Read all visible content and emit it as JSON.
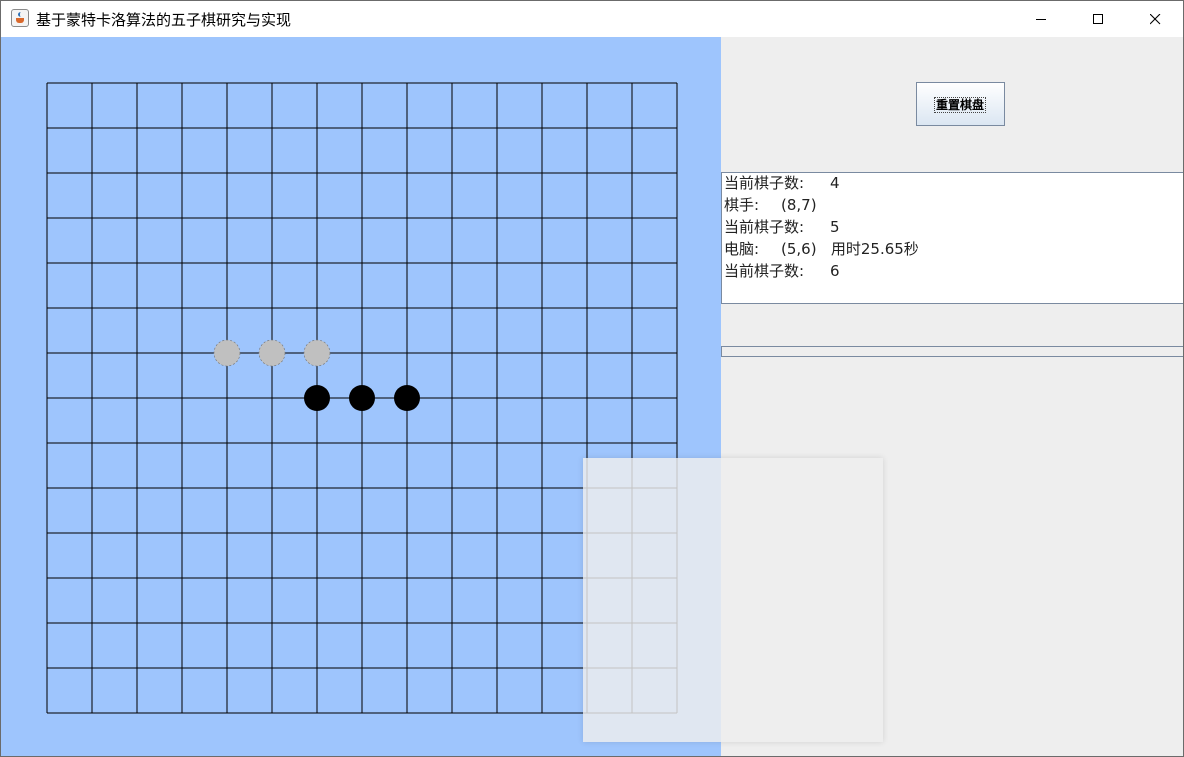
{
  "window": {
    "title": "基于蒙特卡洛算法的五子棋研究与实现",
    "icon": "java-cup-icon"
  },
  "colors": {
    "board_background": "#9ec5fd",
    "grid_line": "#000000",
    "white_stone": "#c0c0c0",
    "black_stone": "#000000",
    "panel_background": "#eeeeee"
  },
  "board": {
    "size": 15,
    "stones": [
      {
        "col": 4,
        "row": 6,
        "color": "white"
      },
      {
        "col": 5,
        "row": 6,
        "color": "white"
      },
      {
        "col": 6,
        "row": 6,
        "color": "white"
      },
      {
        "col": 6,
        "row": 7,
        "color": "black"
      },
      {
        "col": 7,
        "row": 7,
        "color": "black"
      },
      {
        "col": 8,
        "row": 7,
        "color": "black"
      }
    ]
  },
  "controls": {
    "reset_label": "重置棋盘"
  },
  "log": [
    {
      "label": "当前棋子数:",
      "value": "4"
    },
    {
      "label": "棋手:",
      "value": "(8,7)"
    },
    {
      "label": "当前棋子数:",
      "value": "5"
    },
    {
      "label": "电脑:",
      "value": "(5,6)   用时25.65秒"
    },
    {
      "label": "当前棋子数:",
      "value": "6"
    }
  ]
}
